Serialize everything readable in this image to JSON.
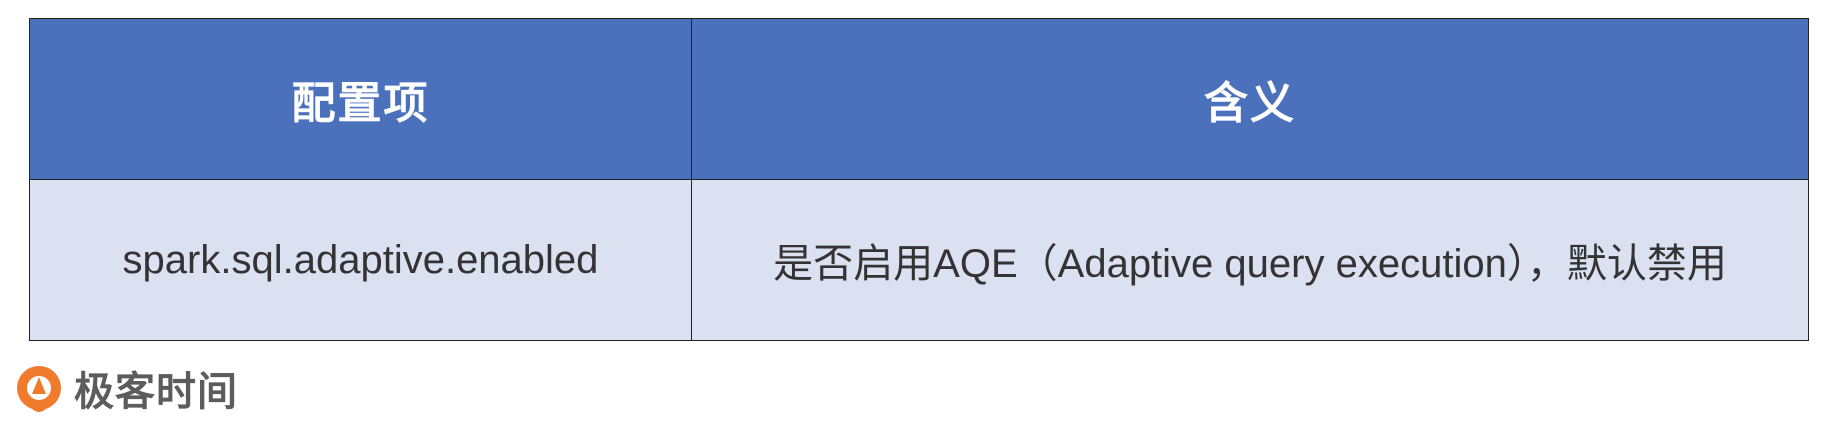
{
  "table": {
    "headers": [
      "配置项",
      "含义"
    ],
    "rows": [
      {
        "key": "spark.sql.adaptive.enabled",
        "meaning": "是否启用AQE（Adaptive query execution），默认禁用"
      }
    ]
  },
  "brand": {
    "name": "极客时间",
    "icon": "geektime-logo-icon",
    "accent_color": "#f07b2c"
  },
  "colors": {
    "header_bg": "#4b71bd",
    "row_bg": "#dbe1f1"
  }
}
